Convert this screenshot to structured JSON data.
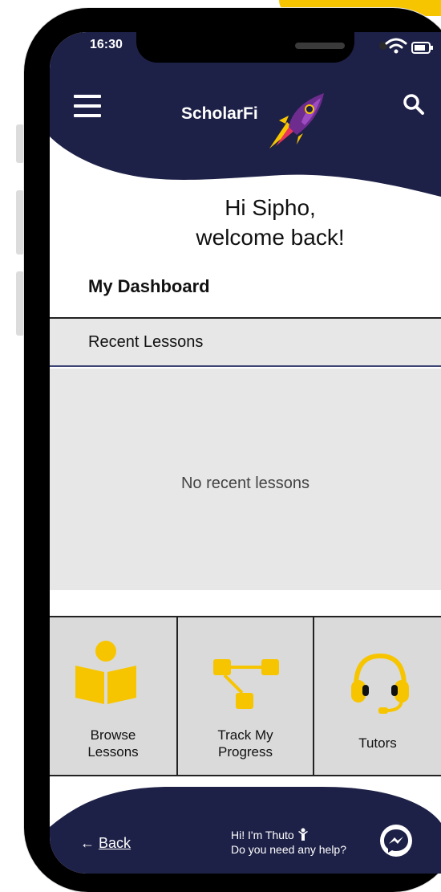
{
  "status_bar": {
    "time": "16:30"
  },
  "header": {
    "app_name": "ScholarFi"
  },
  "greeting": {
    "line1": "Hi Sipho,",
    "line2": "welcome back!"
  },
  "dashboard": {
    "title": "My Dashboard",
    "recent_lessons_label": "Recent Lessons",
    "empty_message": "No recent lessons"
  },
  "tiles": [
    {
      "line1": "Browse",
      "line2": "Lessons",
      "icon": "reader-book-icon"
    },
    {
      "line1": "Track My",
      "line2": "Progress",
      "icon": "flow-progress-icon"
    },
    {
      "line1": "Tutors",
      "line2": "",
      "icon": "headset-icon"
    }
  ],
  "footer": {
    "back_label": "Back",
    "back_arrow": "←",
    "help_line1": "Hi! I'm Thuto",
    "help_line2": "Do you need any help?"
  },
  "colors": {
    "navy": "#1E2147",
    "accent_yellow": "#F7C500",
    "panel_grey": "#E7E7E7",
    "tile_grey": "#DADADA"
  }
}
